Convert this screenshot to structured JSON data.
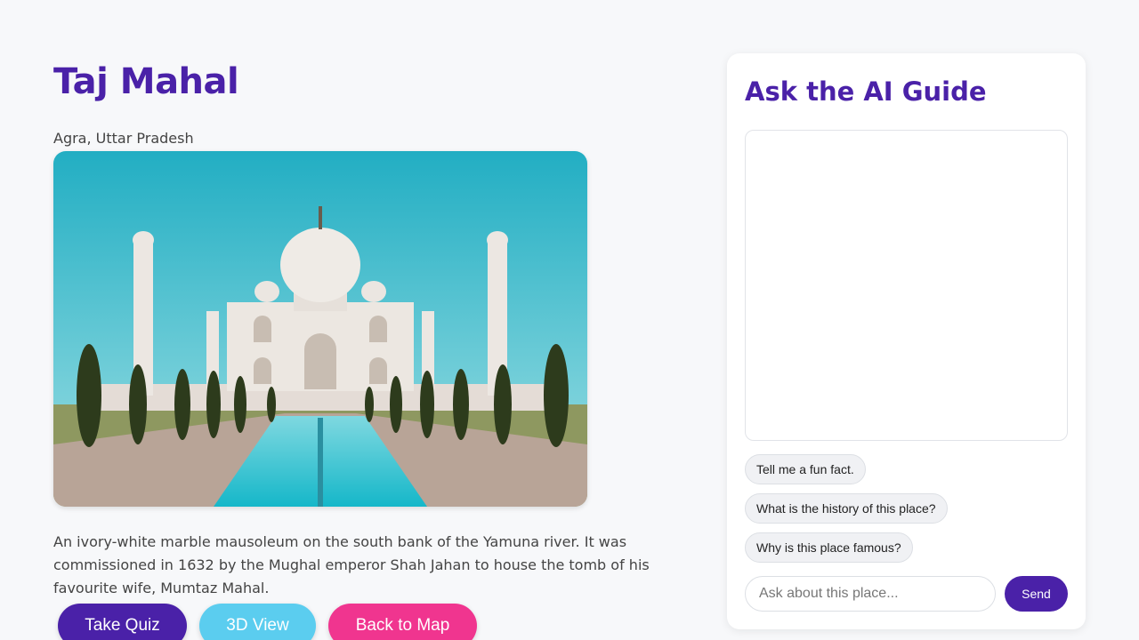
{
  "landmark": {
    "title": "Taj Mahal",
    "location": "Agra, Uttar Pradesh",
    "description": "An ivory-white marble mausoleum on the south bank of the Yamuna river. It was commissioned in 1632 by the Mughal emperor Shah Jahan to house the tomb of his favourite wife, Mumtaz Mahal."
  },
  "actions": {
    "quiz_label": "Take Quiz",
    "view3d_label": "3D View",
    "map_label": "Back to Map"
  },
  "guide": {
    "title": "Ask the AI Guide",
    "suggestions": [
      "Tell me a fun fact.",
      "What is the history of this place?",
      "Why is this place famous?"
    ],
    "input_placeholder": "Ask about this place...",
    "send_label": "Send"
  },
  "colors": {
    "primary": "#4a21a8",
    "cyan": "#5bcdef",
    "pink": "#f0358f",
    "background": "#f7f8fa"
  }
}
